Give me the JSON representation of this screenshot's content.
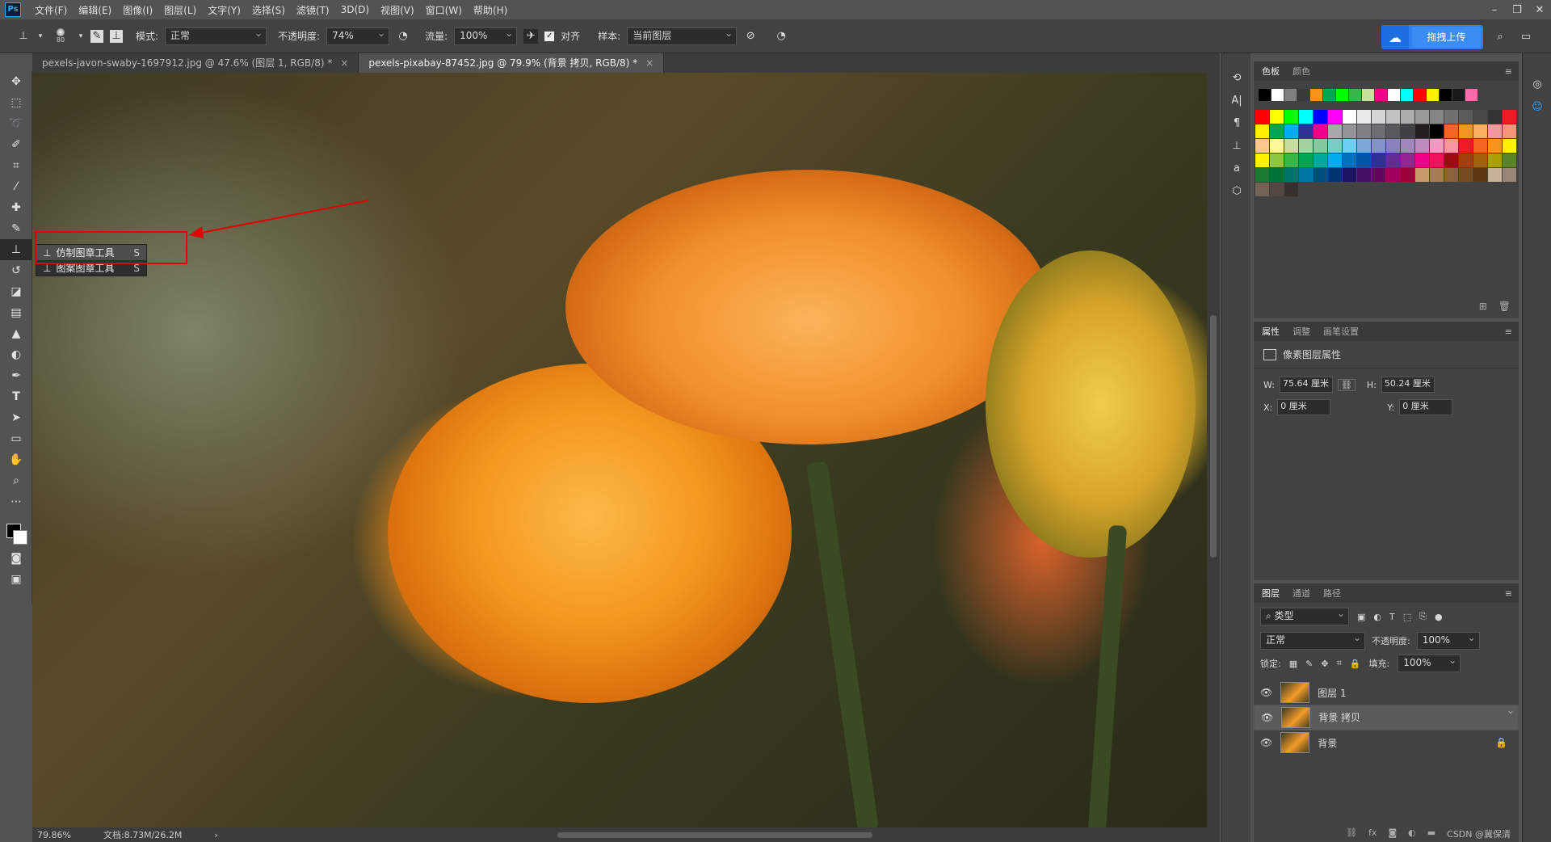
{
  "app": {
    "logo_text": "Ps"
  },
  "menu": [
    "文件(F)",
    "编辑(E)",
    "图像(I)",
    "图层(L)",
    "文字(Y)",
    "选择(S)",
    "滤镜(T)",
    "3D(D)",
    "视图(V)",
    "窗口(W)",
    "帮助(H)"
  ],
  "options": {
    "brush_size": "80",
    "mode_label": "模式:",
    "mode_value": "正常",
    "opacity_label": "不透明度:",
    "opacity_value": "74%",
    "flow_label": "流量:",
    "flow_value": "100%",
    "align_label": "对齐",
    "sample_label": "样本:",
    "sample_value": "当前图层",
    "upload_label": "拖拽上传"
  },
  "tabs": [
    {
      "label": "pexels-javon-swaby-1697912.jpg @ 47.6% (图层 1, RGB/8) *",
      "close": "×"
    },
    {
      "label": "pexels-pixabay-87452.jpg @ 79.9% (背景 拷贝, RGB/8) *",
      "close": "×"
    }
  ],
  "flyout": [
    {
      "label": "仿制图章工具",
      "key": "S"
    },
    {
      "label": "图案图章工具",
      "key": "S"
    }
  ],
  "status": {
    "zoom": "79.86%",
    "doc": "文档:8.73M/26.2M"
  },
  "swatches_panel": {
    "tabs": [
      "色板",
      "颜色"
    ],
    "recent": [
      "#000000",
      "#ffffff",
      "#7f7f7f",
      "#3a3a3a",
      "#f7941d",
      "#00a651",
      "#00ff00",
      "#39b54a",
      "#c7e09a",
      "#ec008c",
      "#ffffff",
      "#00ffff",
      "#ff0000",
      "#fff200",
      "#000000",
      "#1a1a1a",
      "#f06eaa"
    ],
    "rows": [
      [
        "#ff0000",
        "#ffff00",
        "#00ff00",
        "#00ffff",
        "#0000ff",
        "#ff00ff",
        "#ffffff",
        "#ebebeb",
        "#d6d6d6",
        "#c2c2c2",
        "#adadad",
        "#999999",
        "#858585",
        "#707070",
        "#5c5c5c",
        "#474747",
        "#333333",
        "#ed1c24"
      ],
      [
        "#fff200",
        "#00a651",
        "#00aeef",
        "#2e3192",
        "#ec008c",
        "#a7a9ac",
        "#939598",
        "#808285",
        "#6d6e71",
        "#58595b",
        "#414042",
        "#231f20",
        "#000000",
        "#f26522",
        "#f7941d",
        "#fbaf5d",
        "#f5989d",
        "#f69679"
      ],
      [
        "#fdc68a",
        "#fff799",
        "#c4df9b",
        "#a3d39c",
        "#82ca9c",
        "#7accc8",
        "#6dcff6",
        "#7da7d9",
        "#8393ca",
        "#8781bd",
        "#a186be",
        "#bd8cbf",
        "#f49ac2",
        "#f6989d",
        "#ed1c24",
        "#f26522",
        "#f7941d",
        "#fff200"
      ],
      [
        "#fff200",
        "#8dc63f",
        "#39b54a",
        "#00a651",
        "#00a99d",
        "#00aeef",
        "#0072bc",
        "#0054a6",
        "#2e3192",
        "#662d91",
        "#92278f",
        "#ec008c",
        "#ed145b",
        "#9e0b0f",
        "#a0410d",
        "#a36209",
        "#aba000",
        "#598527"
      ],
      [
        "#197b30",
        "#007236",
        "#00746b",
        "#0076a3",
        "#004b80",
        "#003471",
        "#1b1464",
        "#440e62",
        "#630460",
        "#9e005d",
        "#9e0039",
        "#c69c6d",
        "#a67c52",
        "#8c6239",
        "#754c24",
        "#603913",
        "#c7b299",
        "#998675"
      ],
      [
        "#736357",
        "#534741",
        "#37302d"
      ]
    ]
  },
  "properties_panel": {
    "tabs": [
      "属性",
      "调整",
      "画笔设置"
    ],
    "title": "像素图层属性",
    "w_label": "W:",
    "w_value": "75.64 厘米",
    "h_label": "H:",
    "h_value": "50.24 厘米",
    "x_label": "X:",
    "x_value": "0 厘米",
    "y_label": "Y:",
    "y_value": "0 厘米"
  },
  "layers_panel": {
    "tabs": [
      "图层",
      "通道",
      "路径"
    ],
    "filter": "类型",
    "blend": "正常",
    "opacity_label": "不透明度:",
    "opacity_value": "100%",
    "lock_label": "锁定:",
    "fill_label": "填充:",
    "fill_value": "100%",
    "layers": [
      {
        "name": "图层 1",
        "selected": false,
        "locked": false
      },
      {
        "name": "背景 拷贝",
        "selected": true,
        "locked": false
      },
      {
        "name": "背景",
        "selected": false,
        "locked": true
      }
    ],
    "watermark": "CSDN @冀保清"
  }
}
